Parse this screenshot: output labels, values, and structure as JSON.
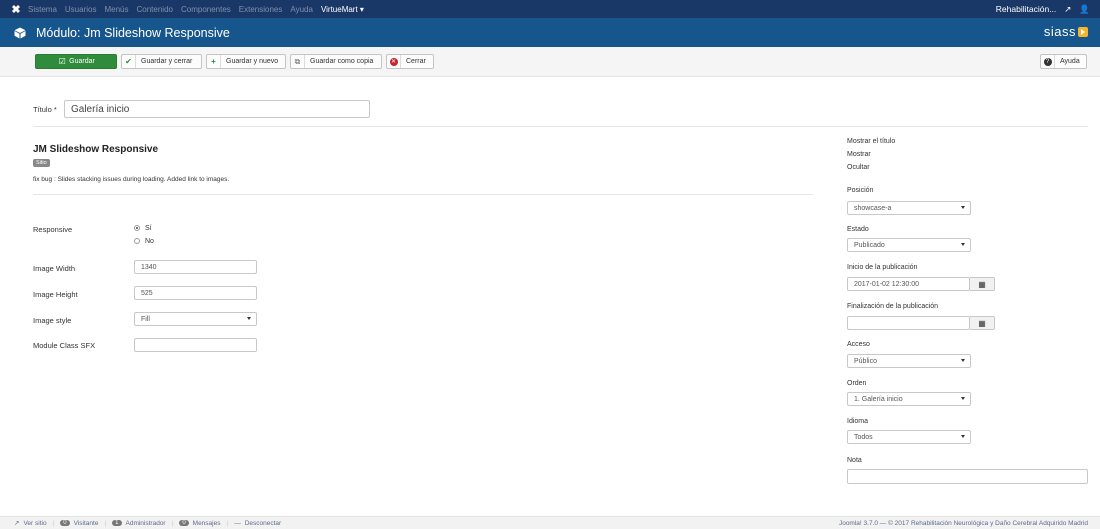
{
  "topnav": {
    "items": [
      "Sistema",
      "Usuarios",
      "Menús",
      "Contenido",
      "Componentes",
      "Extensiones",
      "Ayuda",
      "VirtueMart ▾"
    ],
    "user": "Rehabilitación..."
  },
  "header": {
    "title": "Módulo: Jm Slideshow Responsive",
    "brand": "siass"
  },
  "toolbar": {
    "save": "Guardar",
    "save_close": "Guardar y cerrar",
    "save_new": "Guardar y nuevo",
    "save_copy": "Guardar como copia",
    "close": "Cerrar",
    "help": "Ayuda"
  },
  "form": {
    "title_label": "Título *",
    "title_value": "Galería inicio",
    "module_name": "JM Slideshow Responsive",
    "site_badge": "Sitio",
    "description": "fix bug : Slides stacking issues during loading. Added link to images.",
    "responsive_label": "Responsive",
    "responsive_yes": "Sí",
    "responsive_no": "No",
    "width_label": "Image Width",
    "width_value": "1340",
    "height_label": "Image Height",
    "height_value": "525",
    "style_label": "Image style",
    "style_value": "Fill",
    "sfx_label": "Module Class SFX",
    "sfx_value": ""
  },
  "side": {
    "show_title_label": "Mostrar el título",
    "show_option": "Mostrar",
    "hide_option": "Ocultar",
    "position_label": "Posición",
    "position_value": "showcase-a",
    "state_label": "Estado",
    "state_value": "Publicado",
    "publish_up_label": "Inicio de la publicación",
    "publish_up_value": "2017-01-02 12:30:00",
    "publish_down_label": "Finalización de la publicación",
    "publish_down_value": "",
    "access_label": "Acceso",
    "access_value": "Público",
    "order_label": "Orden",
    "order_value": "1. Galería inicio",
    "language_label": "Idioma",
    "language_value": "Todos",
    "note_label": "Nota",
    "note_value": ""
  },
  "footer": {
    "view_site": "Ver sitio",
    "visitors_count": "0",
    "visitors": "Visitante",
    "admins_count": "1",
    "admins": "Administrador",
    "messages_count": "0",
    "messages": "Mensajes",
    "logout": "Desconectar",
    "copyright": "Joomla! 3.7.0 — © 2017 Rehabilitación Neurológica y Daño Cerebral Adquirido Madrid"
  },
  "colors": {
    "topnav": "#1a3867",
    "header": "#17568c",
    "save_green": "#2e8c3c",
    "brand_accent": "#f7b32b"
  }
}
